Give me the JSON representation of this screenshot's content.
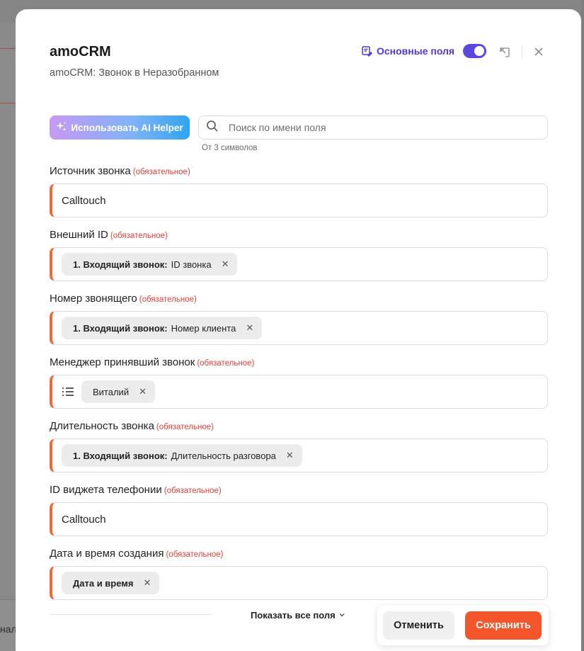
{
  "background": {
    "bottom_text": "нал"
  },
  "header": {
    "title": "amoCRM",
    "subtitle": "amoCRM: Звонок в Неразобранном",
    "main_fields_label": "Основные поля",
    "main_fields_enabled": true,
    "accent_color": "#5b48e0"
  },
  "toolbar": {
    "ai_helper_label": "Использовать AI Helper",
    "search_placeholder": "Поиск по имени поля",
    "search_value": "",
    "search_hint": "От 3 символов"
  },
  "required_label": "(обязательное)",
  "fields": [
    {
      "label": "Источник звонка",
      "type": "text",
      "value": "Calltouch"
    },
    {
      "label": "Внешний ID",
      "type": "chip",
      "chip_prefix": "1. Входящий звонок:",
      "chip_value": "ID звонка"
    },
    {
      "label": "Номер звонящего",
      "type": "chip",
      "chip_prefix": "1. Входящий звонок:",
      "chip_value": "Номер клиента"
    },
    {
      "label": "Менеджер принявший звонок",
      "type": "list-chip",
      "chip_value": "Виталий"
    },
    {
      "label": "Длительность звонка",
      "type": "chip",
      "chip_prefix": "1. Входящий звонок:",
      "chip_value": "Длительность разговора"
    },
    {
      "label": "ID виджета телефонии",
      "type": "text",
      "value": "Calltouch"
    },
    {
      "label": "Дата и время создания",
      "type": "chip-bold",
      "chip_value": "Дата и время"
    }
  ],
  "footer": {
    "show_all_label": "Показать все поля",
    "cancel_label": "Отменить",
    "save_label": "Сохранить",
    "save_color": "#f4552b"
  }
}
